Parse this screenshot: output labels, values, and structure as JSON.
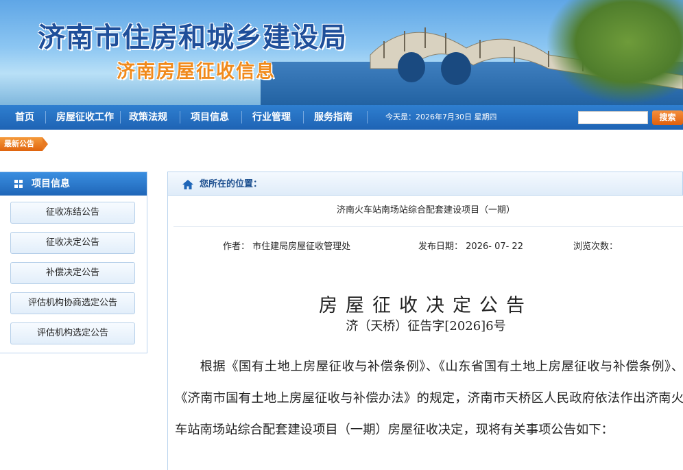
{
  "banner": {
    "title": "济南市住房和城乡建设局",
    "subtitle": "济南房屋征收信息"
  },
  "nav": {
    "items": [
      "首页",
      "房屋征收工作",
      "政策法规",
      "项目信息",
      "行业管理",
      "服务指南"
    ],
    "date_text": "今天是：2026年7月30日 星期四",
    "search_placeholder": "",
    "search_label": "搜索"
  },
  "latest": {
    "label": "最新公告"
  },
  "sidebar": {
    "title": "项目信息",
    "items": [
      "征收冻结公告",
      "征收决定公告",
      "补偿决定公告",
      "评估机构协商选定公告",
      "评估机构选定公告"
    ]
  },
  "breadcrumb": {
    "label": "您所在的位置："
  },
  "article": {
    "project_title": "济南火车站南场站综合配套建设项目（一期）",
    "author_label": "作者：",
    "author": "市住建局房屋征收管理处",
    "date_label": "发布日期：",
    "date": "2026- 07- 22",
    "views_label": "浏览次数：",
    "doc_title": "房屋征收决定公告",
    "doc_number": "济（天桥）征告字[2026]6号",
    "body": "根据《国有土地上房屋征收与补偿条例》、《山东省国有土地上房屋征收与补偿条例》、《济南市国有土地上房屋征收与补偿办法》的规定，济南市天桥区人民政府依法作出济南火车站南场站综合配套建设项目（一期）房屋征收决定，现将有关事项公告如下："
  },
  "colors": {
    "nav_blue": "#1e63b4",
    "search_orange": "#e0600f",
    "banner_title": "#1f4f9a",
    "banner_subtitle": "#f08a1c"
  }
}
